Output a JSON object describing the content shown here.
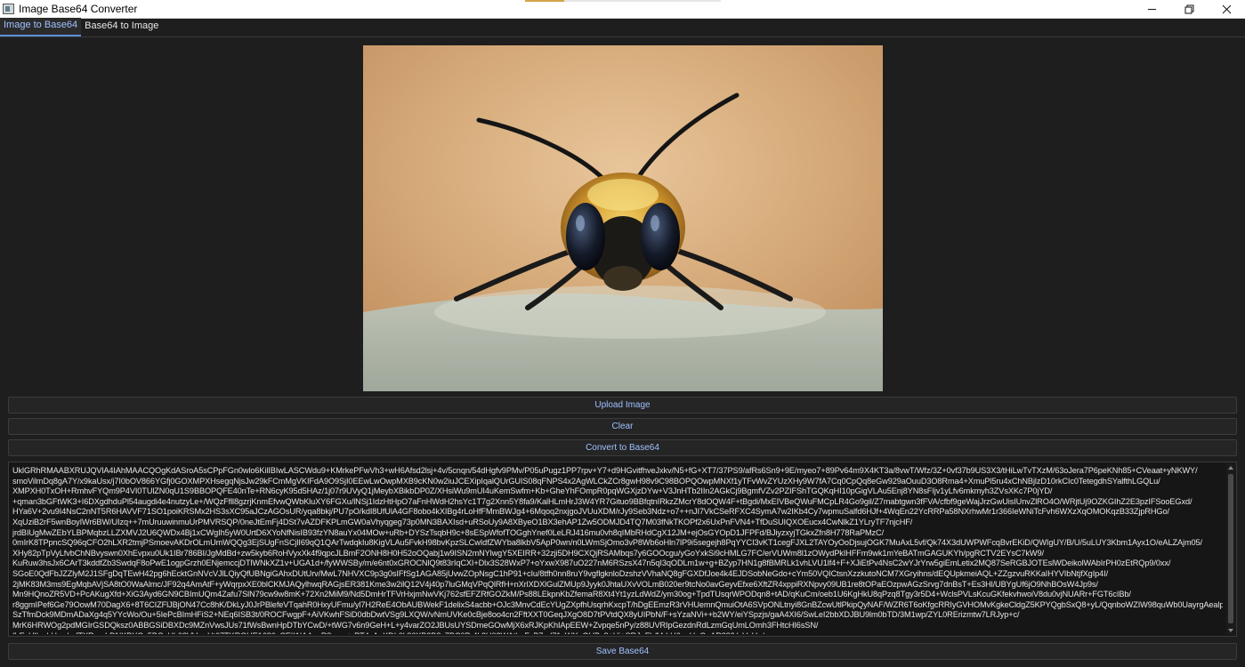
{
  "window": {
    "title": "Image Base64 Converter",
    "controls": [
      "minimize-icon",
      "restore-icon",
      "close-icon"
    ]
  },
  "tabs": [
    {
      "label": "Image to Base64",
      "active": true
    },
    {
      "label": "Base64 to Image",
      "active": false
    }
  ],
  "preview": {
    "subject": "bee-photo"
  },
  "buttons": {
    "upload": "Upload Image",
    "clear": "Clear",
    "convert": "Convert to Base64",
    "save": "Save Base64"
  },
  "output": {
    "lines": [
      "UklGRhRMAABXRUJQVlA4IAhMAACQOgKdASroA5sCPpFGn0wlo6KilIBIwLASCWdu9+KMrkePFwVh3+wH6Afsd2lsj+4v/5cnqn/54dHgfv9PMv/P05uPugz1PP7rpv+Y7+d9HGvitfhveJxkv/N5+fG+XT7/37PS9/afRs6Sn9+9E/myeo7+89Pv64m9X4KT3a/8vwT/Wfz/3Z+0vf37b9US3X3/tHiLwTvTXzM/63oJera7P6peKNh85+CVeaat+yNKWY/",
      "smoVilmDq8gA7Y/x9kaUsx/j7I0bOV866YGfj0GOXMPXHsegqNjsJw29kFCmMgVKIFdA9O9SjI0EEwLwOwpMXB9cKN0w2iuJCEXipIqalQUrGUIS08qFNPS4x2AgWLCkZCr8gwH98v9C98BOPQOwpMNXf1yTFvWvZYUzXHy9W7fA7Cq0CpQq8eGw929aOuuD3O8Rma4+XmuPl5ru4xChNBjlzD10rkCIc0TetegdhSYalfthLGQLu/",
      "XMPXH0TxOH+RmhvFYQm9P4VI0TUlZN0qU1S9BBOPQFE40nTe+RN6cyK95d5HAz/1j07r9UVyQ1jMeybXBikbDP0Z/XHsiWu9mUI4uKemSwfm+Kb+GheYhFOmpR0pqWGXjzDYw+V3JnHTb2IIn2AGkCj9BgmfVZv2PZIFShTGQKqHI10pGigVLAu5Enj8YN8sFIjv1yLfv6mkmyh3ZVsXKc7P0jYD/",
      "+qman3bGFtWK3+I6DXgdhduPl54augdi4e4nutzyLe+/WQzFfll8gzrjKnmEfvwQWbKluXY6FGXu/lNSj1IdzHtHpO7aFnHWdH2hsYc1T7g2Xnn5Y8fa9/KalHLmHrJ3W4YR7Gituo9BBfqtnIRkzZMcrY8dOQW4F+tBgdi/MxEIVBeQWuFMCpLR4Go9gil/Z7mabtgwn3fFVA/cfbf9geWajJrzGwUisIUnvZlRO4O/WRjtUj9OZKGIhZ2E3pzIFSooEGxd/",
      "HYa6V+2vu9I4NsC2nNT5R6HAVVF71SO1poiKRSMx2HS3sXC95aJCzAGOsUR/yqa8bkj/PU7pO/kdI8UfUlA4GF8obo4kXIBg4rLoHfFMmBWJg4+6Mqoq2nxjgoJVUuXDM/rJy9Seb3Ndz+o7++nJI7VkCSeRFXC4SymA7w2IKb4Cy7wpmuSalfd6HJf+4WqEn22YcRRPa58NXrhwMr1r366IeWNiTcFvh6WXzXqOMOKqzB33ZjpRHGo/",
      "XqUziB2rF5wnBoyIWr6BW/UIzq++7mUruuwinmuUrPMVRSQP/0neJtEmFj4DSt7vAZDFKPLmGW0aVhyqgeg73p0MN3BAXIsd+uRSoUy9A8XByeO1BX3ehAP1Zw5ODMJD4TQ7M03fNkTKOPf2x6UxPnFVN4+TfDuSUIQXOEucx4CwNlkZ1YLryTF7njcHF/",
      "jrdBIUgMwZEbYLBPMqbzLLZXMVJ2U6QWDx4Bj1xCWgIh5yW0UrtD6XYoNfNisIB93fzYN8auYx04MOw+uRb+DYSzTsqbH9c+8sESpWfofTOGghYnef0LeLRJ416mu0vh8qIMbRHdCgX12JM+ejOsGYOpD1JFPFd/BJiyzxyjTGkxZfn8H778RaPMzC/",
      "0mIrK8TPpncSQ96qCFO2hLXR2tmjPSmoevAKDrOLmUmWQQg3EjSUgFnSCjlI69qQ1QArTwdqkIu8KigVLAu5FvkH98bvKpzSLCwIdfZWYba8lkbV5ApP0wn/n0LWmSjOmo3vP8Wb6oHln7lP9i5segejh8PqYYCI3vKT1cegFJXL2TAYOyOoDjsujOGK7MuAxL5vf/Qk74X3dUWPWFcqBvrEKiD/QWIgUY/B/U/5uLUY3Kbm1Ayx1O/eALZAjm05/",
      "XHy82pTpVyLfvbChNBvyswn0XhEvpxu0Uk1IBr786BI/JgMdBd+zw5kyb6RoHVyxXk4f9qpcJLBmF2ONH8H0H52oOQabj1w9ISN2mNYlwgY5XEIRR+32zji5DH9CXQjRSAMbqs7y6GOOcgu/yGoYxkSi9cHMLG7FC/erVUWm8l1zOWydPkIHFFm9wk1mYeBATmGAGUKYh/pgRCTV2EYsC7kW9/",
      "KuRuw3hsJx6CArT3kddfZb3SwdqF8oPwE1ogpGrzh0ENjemccjDTlWNkXZ1v+UGA1d+/fyWWSBy/m/e6nt0xGROCNlQ9t83rIqCXI+Dlx3S28WxP7+oYxwX987uO227nM6RSzsX47n5qI3qODLm1w+g+BZyp7HN1g8fBMRLk1vhLVU1lf4+F+XJiEtPv4NsC2wYJrYrw5giEmLetix2MQ87SeRGBJOTEslWDeikolWAbIrPH0zEtRQp9/0xx/",
      "SGoE0QdFbJZZlyM2J1SFgDqTEwH42pg6hEcktGnNVcVJlLQiyQfUBNgiGAhxDUtUrv/MwL7NHVXC9p3g0sIFfSg1AGA85jUvwZOpNsgC1hP91+cIu/8tfh0nn8ruY9vgflgknloDzshzVVhaNQ8gFGXDfJoe4k4EJDSobNeGdo+cYm50VQICtsnXzzkutoNCM7XGryihns/dEQUpkmeiAQL+ZZgzvuRKKaIHYVIbNtjfXgIp4I/",
      "2jMK83M3ms9EgMqbAVjSA8tO0WaAlmc/JF92q4AmAtF+yWqrpxXE0blCKMJAQylhwqRAGjsER381Kme3w2ilQ12V4j40p7luGMqVPqQlRfH+nXrlXDXlGulZMUp9Jyyk0JhtaUXvVOLmB020er9tcNo0avGeyvEfxe6XftZR4xppiRXNpvy09UB1re8tOPaEOzpwAGzSrvg7dnBsT+Es3Hl/UBYgUf6jO9NhBOsW4Jp9s/",
      "Mn9HQnoZR5VD+PcAKugXfd+XiG3Ayd6GN9CBImUQm4Zafu7SlN79cw9w8mK+72Xn2MiM9/Nd5DmHrTFVrHxjmNwVKj762sfEFZRfGOZkM/Ps88LEkpnKbZfemaR8Xt4Yt1yzLdWdZ/ym30og+TpdTUsqrWPODqn8+tAD/qKuCm/oeb1U6KgHkU8qPzq8Tgy3r5D4+WclsPVLsKcuGKfekvhwoiV8du0vjNUARr+FGT6cIBb/",
      "r8ggmIPef6Ge79OowM70DagX6+8T6CIZFlJBjON47Cc8hK/DkLyJ0JrPBlefeVTqahR0HxyUFmu/yl7H2ReE4ObAUBWekF1delixS4acbb+OJc3MnvCdEcYUgZXpfhUsqrhKxcpT/hDgEEmzR3rVHUemnQmuiOtA6SVpONLtnyi8GnBZcwUtlPkipQyNAF/WZR6T6oKfgcRRIyGVHOMvKgkeCldgZ5KPYQgbSxQ8+yL/QqnboWZIW98quWb0UayrgAealpLa/",
      "SzTfmDck9MDmADaXg4q5YYcWo/Ou+5IePcBImHFiS2+NEq6ISB3t/0ROCFwgpF+AiVKwhFSiD0dbDwtVSg9LXQW/vNmUVKe0cBje8oo4cn2FftXXT0GeqJXgO8D7tPVtdQX8yUIPbN/F+sYzaNVi++b2WY/eiYSpzjs/gaA4XI6/SwLeI2bbXDJBU9lm0bTD/3M1wp/ZYL0RErizmtw7LRJyp+c/",
      "MrK6HRWOg2pdMGIrGSDQksz0ABBGSiDBXDc9MZnVwsJUs71fWsBwnHpDTbYCwD/+tWG7v6n9GeH+L+y4varZO2JBUsUYSDmeGOwMjX6xRJKpKhIApEEW+Zvpqe5nPy/z88UVRIpGezdnRdLzmGqUmLOrnh3FHtcHI6sSN/",
      "fbEsUlIwrhHewhvfTXRmqhDNKBYOc5BQzUh02VVvwHt07TKROUE1680vCEII1IAAgzR8wwy+rPT4yAnKDL0k86XB2B8y7BC0Pr4k2U02WAtbpFvB7ad71zWXqGUBc8+Ui+SRJnFh/MdrH6eqHoGuAR38fVpVaUq/"
    ]
  }
}
